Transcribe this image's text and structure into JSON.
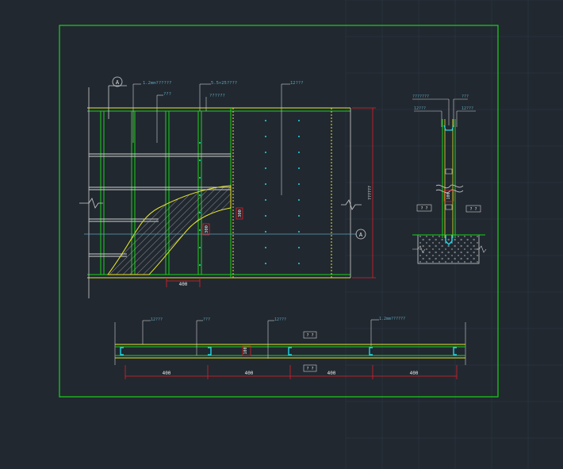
{
  "colors": {
    "background": "#212830",
    "grid": "#2c3540",
    "frame": "#19d219",
    "wall_yellow": "#e6e62a",
    "annotation": "#5fa3b8",
    "dimension_red": "#e0202a",
    "stud_cyan": "#22d6e6",
    "white_text": "#e8e8e8",
    "leader_white": "#d0d0d0"
  },
  "elevation": {
    "callout_top": "A",
    "callout_right": "A",
    "label_board": "1.2mm??????",
    "label_screw": "???",
    "label_self_tap": "5.5×25????",
    "label_keel": "??????",
    "label_panel": "12???",
    "dim_bottom": "400",
    "dim_horizontal": "300",
    "dim_vertical_mid": "300",
    "dim_height_right": "??????"
  },
  "section_side": {
    "label_a": "???????",
    "label_b": "12???",
    "label_c": "???",
    "label_d": "12???",
    "dim_center": "100",
    "tag_left": "? ?",
    "tag_right": "? ?"
  },
  "plan": {
    "label_board_left": "12???",
    "label_stud": "???",
    "label_board_mid": "12???",
    "label_steel": "1.2mm??????",
    "tag_top": "? ?",
    "tag_bottom": "? ?",
    "dim_thickness": "100",
    "dims": [
      "400",
      "400",
      "400",
      "400"
    ]
  }
}
